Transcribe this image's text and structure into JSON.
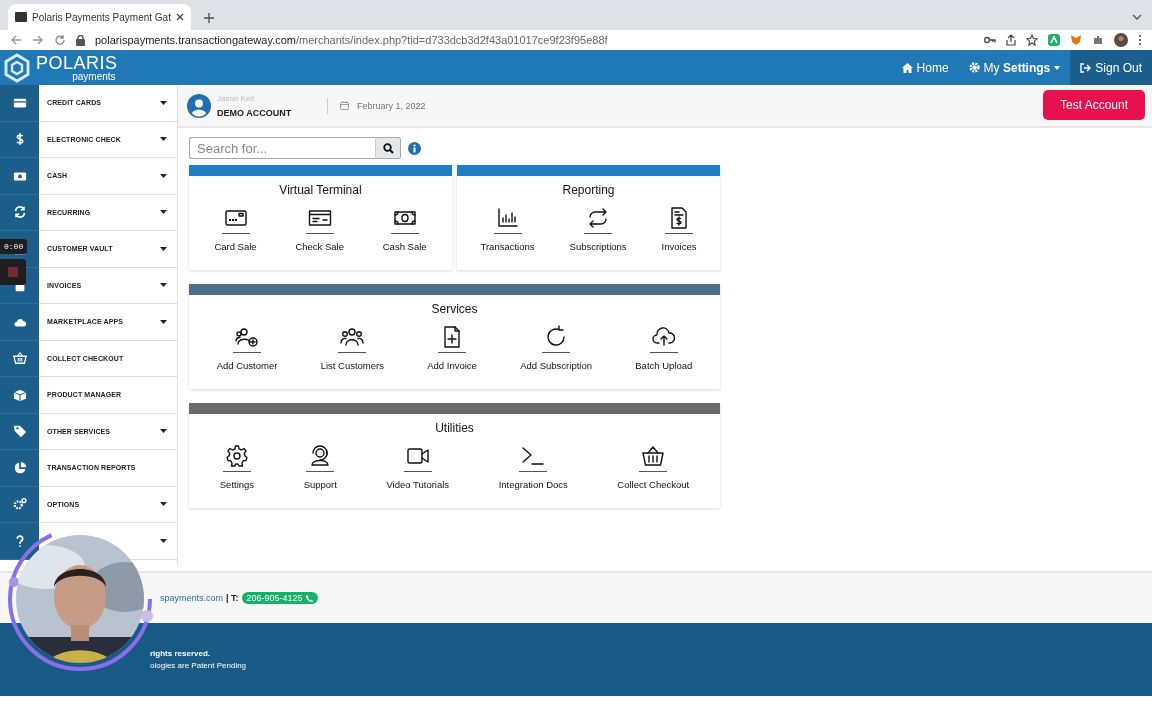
{
  "browser": {
    "tab_title": "Polaris Payments Payment Gat",
    "url_host": "polarispayments.transactiongateway.com",
    "url_path": "/merchants/index.php?tid=d733dcb3d2f43a01017ce9f23f95e88f"
  },
  "header": {
    "logo_name": "POLARIS",
    "logo_sub": "payments",
    "nav": [
      {
        "label": "Home",
        "kind": "home",
        "active": false
      },
      {
        "label": "My **Settings**",
        "kind": "settings",
        "active": false
      },
      {
        "label": "Sign Out",
        "kind": "signout",
        "active": true
      }
    ]
  },
  "sidebar": {
    "items": [
      {
        "label": "CREDIT CARDS",
        "has_caret": true
      },
      {
        "label": "ELECTRONIC CHECK",
        "has_caret": true
      },
      {
        "label": "CASH",
        "has_caret": true
      },
      {
        "label": "RECURRING",
        "has_caret": true
      },
      {
        "label": "CUSTOMER VAULT",
        "has_caret": true
      },
      {
        "label": "INVOICES",
        "has_caret": true
      },
      {
        "label": "MARKETPLACE APPS",
        "has_caret": true
      },
      {
        "label": "COLLECT CHECKOUT",
        "has_caret": false
      },
      {
        "label": "PRODUCT MANAGER",
        "has_caret": false
      },
      {
        "label": "OTHER SERVICES",
        "has_caret": true
      },
      {
        "label": "TRANSACTION REPORTS",
        "has_caret": false
      },
      {
        "label": "OPTIONS",
        "has_caret": true
      },
      {
        "has_caret": true
      }
    ]
  },
  "account": {
    "user": "Jason Keil",
    "name": "DEMO ACCOUNT",
    "date": "February 1, 2022",
    "test_button": "Test Account"
  },
  "search": {
    "placeholder": "Search for..."
  },
  "panels": [
    {
      "title": "Virtual Terminal",
      "color": "#1f7fc4",
      "tiles": [
        "Card Sale",
        "Check Sale",
        "Cash Sale"
      ]
    },
    {
      "title": "Reporting",
      "color": "#1f7fc4",
      "tiles": [
        "Transactions",
        "Subscriptions",
        "Invoices"
      ]
    },
    {
      "title": "Services",
      "color": "#4d6f8f",
      "tiles": [
        "Add Customer",
        "List Customers",
        "Add Invoice",
        "Add Subscription",
        "Batch Upload"
      ]
    },
    {
      "title": "Utilities",
      "color": "#6b6b6b",
      "tiles": [
        "Settings",
        "Support",
        "Video Tutorials",
        "Integration Docs",
        "Collect Checkout"
      ]
    }
  ],
  "footer": {
    "contact_link": "spayments.com",
    "phone_label": "| T:",
    "phone": "206-905-4125",
    "copyright": "rights reserved.",
    "patent": "ologies are Patent Pending"
  },
  "recorder": {
    "timer": "0:00"
  }
}
